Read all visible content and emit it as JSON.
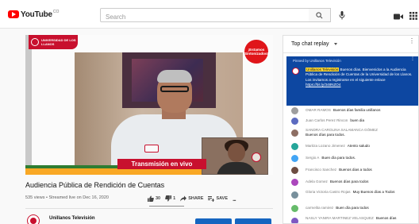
{
  "topbar": {
    "logo_text": "YouTube",
    "logo_region": "CO",
    "search_placeholder": "Search",
    "icons": [
      "search-icon",
      "mic-icon",
      "create-video-icon",
      "apps-icon"
    ]
  },
  "video": {
    "logo_text": "UNIVERSIDAD DE LOS LLANOS",
    "corner_badge": "¡Estamos Sintonizados!",
    "live_banner": "Transmisión en vivo",
    "title": "Audiencia Pública de Rendición de Cuentas",
    "meta": "535 views • Streamed live on Dec 16, 2020",
    "likes": "30",
    "dislikes": "1",
    "share_label": "SHARE",
    "save_label": "SAVE",
    "more_label": "...",
    "channel_name": "Unillanos Televisión",
    "colors": {
      "brand_red": "#c8102e",
      "pinned_bg": "#0d47a1",
      "author_highlight": "#fdd835",
      "stripe_green": "#2e7d32",
      "stripe_yellow": "#f9a825"
    }
  },
  "chat": {
    "header": "Top chat replay",
    "pinned": {
      "label": "Pinned by Unillanos Televisión",
      "author": "Unillanos Televisión",
      "text": "Buenos días. Bienvenidos a la Audiencia Pública de Rendición de Cuentas de la Universidad de los Llanos. Los invitamos a registrarse en el siguiente enlace",
      "link": "https://bit.ly/348NZO4"
    },
    "messages": [
      {
        "author": "OMAR RAMOS",
        "text": "Buenos días familia unillanos",
        "avatar_color": "#9e9e9e"
      },
      {
        "author": "Juan Carlos Perez Rincon",
        "text": "buen dia",
        "avatar_color": "#5c6bc0"
      },
      {
        "author": "SANDRA CAROLINA SALAMANCA GÓMEZ",
        "text": "Buenos días para todos.",
        "avatar_color": "#8d6e63"
      },
      {
        "author": "Maritza Lozano Jimenez",
        "text": "Atento saludo",
        "avatar_color": "#26a69a"
      },
      {
        "author": "Sergio A",
        "text": "Buen día para todos.",
        "avatar_color": "#42a5f5"
      },
      {
        "author": "Francisco Sanchez",
        "text": "Buenos dias a todos",
        "avatar_color": "#6d4c41"
      },
      {
        "author": "Adela Gomez",
        "text": "Buenos días para todos",
        "avatar_color": "#ab47bc"
      },
      {
        "author": "Gloria Victoria Castro Rojas",
        "text": "Muy Buenos días a Todos",
        "avatar_color": "#78909c"
      },
      {
        "author": "carmelita ramirez",
        "text": "Buen día para todos",
        "avatar_color": "#66bb6a"
      },
      {
        "author": "NASLY YANIRA MARTINEZ VELASQUEZ",
        "text": "Buenos días",
        "avatar_color": "#7e57c2"
      }
    ]
  }
}
